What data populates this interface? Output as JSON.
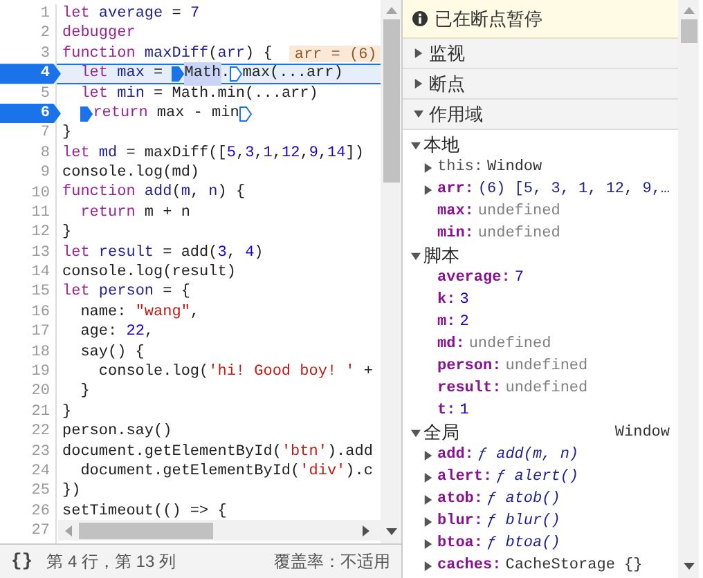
{
  "editor": {
    "lines": [
      {
        "number": "1",
        "breakpoint": false,
        "current": false,
        "tokens": [
          {
            "text": "let",
            "kind": "kw"
          },
          {
            "text": " average",
            "kind": "def"
          },
          {
            "text": " = ",
            "kind": "plain"
          },
          {
            "text": "7",
            "kind": "num"
          }
        ]
      },
      {
        "number": "2",
        "breakpoint": false,
        "current": false,
        "tokens": [
          {
            "text": "debugger",
            "kind": "kw"
          }
        ]
      },
      {
        "number": "3",
        "breakpoint": false,
        "current": false,
        "tokens": [
          {
            "text": "function",
            "kind": "kw"
          },
          {
            "text": " maxDiff",
            "kind": "def"
          },
          {
            "text": "(",
            "kind": "plain"
          },
          {
            "text": "arr",
            "kind": "def"
          },
          {
            "text": ") {",
            "kind": "plain"
          }
        ],
        "inline_value": "arr = (6)"
      },
      {
        "number": "4",
        "breakpoint": true,
        "current": true,
        "tokens": [
          {
            "text": "  let",
            "kind": "kw"
          },
          {
            "text": " max",
            "kind": "def"
          },
          {
            "text": " = ",
            "kind": "plain"
          },
          {
            "kind": "marker",
            "filled": true
          },
          {
            "text": "Math",
            "kind": "hl"
          },
          {
            "text": ".",
            "kind": "plain"
          },
          {
            "kind": "marker",
            "filled": false
          },
          {
            "text": "max(...arr)",
            "kind": "plain"
          }
        ]
      },
      {
        "number": "5",
        "breakpoint": false,
        "current": false,
        "tokens": [
          {
            "text": "  let",
            "kind": "kw"
          },
          {
            "text": " min",
            "kind": "def"
          },
          {
            "text": " = Math.min(...arr)",
            "kind": "plain"
          }
        ]
      },
      {
        "number": "6",
        "breakpoint": true,
        "current": false,
        "tokens": [
          {
            "kind": "marker",
            "filled": true
          },
          {
            "text": "return",
            "kind": "kw"
          },
          {
            "text": " max - min",
            "kind": "plain"
          },
          {
            "kind": "marker",
            "filled": false
          }
        ]
      },
      {
        "number": "7",
        "breakpoint": false,
        "current": false,
        "tokens": [
          {
            "text": "}",
            "kind": "plain"
          }
        ]
      },
      {
        "number": "8",
        "breakpoint": false,
        "current": false,
        "tokens": [
          {
            "text": "let",
            "kind": "kw"
          },
          {
            "text": " md",
            "kind": "def"
          },
          {
            "text": " = maxDiff([",
            "kind": "plain"
          },
          {
            "text": "5",
            "kind": "num"
          },
          {
            "text": ",",
            "kind": "plain"
          },
          {
            "text": "3",
            "kind": "num"
          },
          {
            "text": ",",
            "kind": "plain"
          },
          {
            "text": "1",
            "kind": "num"
          },
          {
            "text": ",",
            "kind": "plain"
          },
          {
            "text": "12",
            "kind": "num"
          },
          {
            "text": ",",
            "kind": "plain"
          },
          {
            "text": "9",
            "kind": "num"
          },
          {
            "text": ",",
            "kind": "plain"
          },
          {
            "text": "14",
            "kind": "num"
          },
          {
            "text": "])",
            "kind": "plain"
          }
        ]
      },
      {
        "number": "9",
        "breakpoint": false,
        "current": false,
        "tokens": [
          {
            "text": "console.log(md)",
            "kind": "plain"
          }
        ]
      },
      {
        "number": "10",
        "breakpoint": false,
        "current": false,
        "tokens": [
          {
            "text": "function",
            "kind": "kw"
          },
          {
            "text": " add",
            "kind": "def"
          },
          {
            "text": "(",
            "kind": "plain"
          },
          {
            "text": "m",
            "kind": "def"
          },
          {
            "text": ", ",
            "kind": "plain"
          },
          {
            "text": "n",
            "kind": "def"
          },
          {
            "text": ") {",
            "kind": "plain"
          }
        ]
      },
      {
        "number": "11",
        "breakpoint": false,
        "current": false,
        "tokens": [
          {
            "text": "  return",
            "kind": "kw"
          },
          {
            "text": " m + n",
            "kind": "plain"
          }
        ]
      },
      {
        "number": "12",
        "breakpoint": false,
        "current": false,
        "tokens": [
          {
            "text": "}",
            "kind": "plain"
          }
        ]
      },
      {
        "number": "13",
        "breakpoint": false,
        "current": false,
        "tokens": [
          {
            "text": "let",
            "kind": "kw"
          },
          {
            "text": " result",
            "kind": "def"
          },
          {
            "text": " = add(",
            "kind": "plain"
          },
          {
            "text": "3",
            "kind": "num"
          },
          {
            "text": ", ",
            "kind": "plain"
          },
          {
            "text": "4",
            "kind": "num"
          },
          {
            "text": ")",
            "kind": "plain"
          }
        ]
      },
      {
        "number": "14",
        "breakpoint": false,
        "current": false,
        "tokens": [
          {
            "text": "console.log(result)",
            "kind": "plain"
          }
        ]
      },
      {
        "number": "15",
        "breakpoint": false,
        "current": false,
        "tokens": [
          {
            "text": "let",
            "kind": "kw"
          },
          {
            "text": " person",
            "kind": "def"
          },
          {
            "text": " = {",
            "kind": "plain"
          }
        ]
      },
      {
        "number": "16",
        "breakpoint": false,
        "current": false,
        "tokens": [
          {
            "text": "  name: ",
            "kind": "plain"
          },
          {
            "text": "\"wang\"",
            "kind": "str"
          },
          {
            "text": ",",
            "kind": "plain"
          }
        ]
      },
      {
        "number": "17",
        "breakpoint": false,
        "current": false,
        "tokens": [
          {
            "text": "  age: ",
            "kind": "plain"
          },
          {
            "text": "22",
            "kind": "num"
          },
          {
            "text": ",",
            "kind": "plain"
          }
        ]
      },
      {
        "number": "18",
        "breakpoint": false,
        "current": false,
        "tokens": [
          {
            "text": "  say() {",
            "kind": "plain"
          }
        ]
      },
      {
        "number": "19",
        "breakpoint": false,
        "current": false,
        "tokens": [
          {
            "text": "    console.log(",
            "kind": "plain"
          },
          {
            "text": "'hi! Good boy! '",
            "kind": "str"
          },
          {
            "text": " +",
            "kind": "plain"
          }
        ]
      },
      {
        "number": "20",
        "breakpoint": false,
        "current": false,
        "tokens": [
          {
            "text": "  }",
            "kind": "plain"
          }
        ]
      },
      {
        "number": "21",
        "breakpoint": false,
        "current": false,
        "tokens": [
          {
            "text": "}",
            "kind": "plain"
          }
        ]
      },
      {
        "number": "22",
        "breakpoint": false,
        "current": false,
        "tokens": [
          {
            "text": "person.say()",
            "kind": "plain"
          }
        ]
      },
      {
        "number": "23",
        "breakpoint": false,
        "current": false,
        "tokens": [
          {
            "text": "document.getElementById(",
            "kind": "plain"
          },
          {
            "text": "'btn'",
            "kind": "str"
          },
          {
            "text": ").add",
            "kind": "plain"
          }
        ]
      },
      {
        "number": "24",
        "breakpoint": false,
        "current": false,
        "tokens": [
          {
            "text": "  document.getElementById(",
            "kind": "plain"
          },
          {
            "text": "'div'",
            "kind": "str"
          },
          {
            "text": ").c",
            "kind": "plain"
          }
        ]
      },
      {
        "number": "25",
        "breakpoint": false,
        "current": false,
        "tokens": [
          {
            "text": "})",
            "kind": "plain"
          }
        ]
      },
      {
        "number": "26",
        "breakpoint": false,
        "current": false,
        "tokens": [
          {
            "text": "setTimeout(() => {",
            "kind": "plain"
          }
        ]
      },
      {
        "number": "27",
        "breakpoint": false,
        "current": false
      }
    ]
  },
  "status_bar": {
    "format_button": "{}",
    "position": "第 4 行，第 13 列",
    "coverage": "覆盖率：不适用"
  },
  "debugger": {
    "banner": "已在断点暂停",
    "panes": [
      {
        "label": "监视",
        "expanded": false
      },
      {
        "label": "断点",
        "expanded": false
      },
      {
        "label": "作用域",
        "expanded": true
      }
    ],
    "scopes": [
      {
        "label": "本地",
        "expanded": true,
        "items": [
          {
            "name": "this:",
            "internal": true,
            "value": "Window",
            "kind": "object",
            "expandable": true,
            "expanded": false
          },
          {
            "name": "arr:",
            "internal": false,
            "value": "(6) [5, 3, 1, 12, 9,…",
            "kind": "array",
            "expandable": true,
            "expanded": false
          },
          {
            "name": "max:",
            "internal": false,
            "value": "undefined",
            "kind": "undefined",
            "expandable": false
          },
          {
            "name": "min:",
            "internal": false,
            "value": "undefined",
            "kind": "undefined",
            "expandable": false
          }
        ]
      },
      {
        "label": "脚本",
        "expanded": true,
        "items": [
          {
            "name": "average:",
            "internal": false,
            "value": "7",
            "kind": "number",
            "expandable": false
          },
          {
            "name": "k:",
            "internal": false,
            "value": "3",
            "kind": "number",
            "expandable": false
          },
          {
            "name": "m:",
            "internal": false,
            "value": "2",
            "kind": "number",
            "expandable": false
          },
          {
            "name": "md:",
            "internal": false,
            "value": "undefined",
            "kind": "undefined",
            "expandable": false
          },
          {
            "name": "person:",
            "internal": false,
            "value": "undefined",
            "kind": "undefined",
            "expandable": false
          },
          {
            "name": "result:",
            "internal": false,
            "value": "undefined",
            "kind": "undefined",
            "expandable": false
          },
          {
            "name": "t:",
            "internal": false,
            "value": "1",
            "kind": "number",
            "expandable": false
          }
        ]
      },
      {
        "label": "全局",
        "expanded": true,
        "scope_value": "Window",
        "items": [
          {
            "name": "add:",
            "internal": false,
            "value": "ƒ add(m, n)",
            "kind": "function",
            "expandable": true,
            "expanded": false
          },
          {
            "name": "alert:",
            "internal": false,
            "value": "ƒ alert()",
            "kind": "function",
            "expandable": true,
            "expanded": false
          },
          {
            "name": "atob:",
            "internal": false,
            "value": "ƒ atob()",
            "kind": "function",
            "expandable": true,
            "expanded": false
          },
          {
            "name": "blur:",
            "internal": false,
            "value": "ƒ blur()",
            "kind": "function",
            "expandable": true,
            "expanded": false
          },
          {
            "name": "btoa:",
            "internal": false,
            "value": "ƒ btoa()",
            "kind": "function",
            "expandable": true,
            "expanded": false
          },
          {
            "name": "caches:",
            "internal": false,
            "value": "CacheStorage {}",
            "kind": "object",
            "expandable": true,
            "expanded": false
          }
        ]
      }
    ]
  }
}
